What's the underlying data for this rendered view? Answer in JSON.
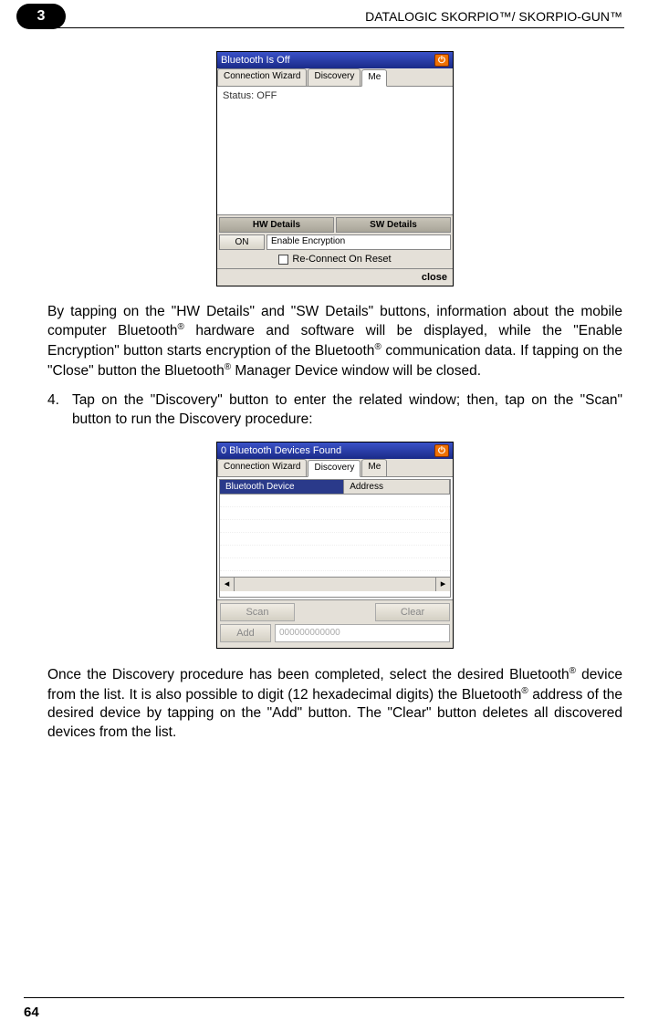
{
  "chapter_badge": "3",
  "header_title": "DATALOGIC SKORPIO™/ SKORPIO-GUN™",
  "page_number": "64",
  "screenshot1": {
    "title": "Bluetooth Is Off",
    "tabs": {
      "conn": "Connection Wizard",
      "disc": "Discovery",
      "me": "Me"
    },
    "status": "Status: OFF",
    "hw_details": "HW Details",
    "sw_details": "SW Details",
    "on_btn": "ON",
    "enable_enc": "Enable Encryption",
    "reconnect": "Re-Connect On Reset",
    "close": "close"
  },
  "para1_a": "By tapping on the \"HW Details\" and \"SW Details\" buttons, information about the mobile computer Bluetooth",
  "para1_b": " hardware and software will be displayed, while the \"Enable Encryption\" button starts encryption of the Bluetooth",
  "para1_c": " communication data. If tapping on the \"Close\" button the Bluetooth",
  "para1_d": " Manager Device window will be closed.",
  "step4_num": "4.",
  "step4_text": "Tap on the \"Discovery\" button to enter the related window; then, tap on the \"Scan\" button to run the Discovery procedure:",
  "screenshot2": {
    "title": "0 Bluetooth Devices Found",
    "tabs": {
      "conn": "Connection Wizard",
      "disc": "Discovery",
      "me": "Me"
    },
    "col1": "Bluetooth Device",
    "col2": "Address",
    "scan": "Scan",
    "clear": "Clear",
    "add": "Add",
    "addr_ph": "000000000000"
  },
  "para2_a": "Once the Discovery procedure has been completed, select the desired Bluetooth",
  "para2_b": " device from the list. It is also possible to digit (12 hexadecimal digits) the Bluetooth",
  "para2_c": " address of the desired device by tapping on the \"Add\" button. The \"Clear\" button deletes all discovered devices from the list.",
  "reg": "®"
}
